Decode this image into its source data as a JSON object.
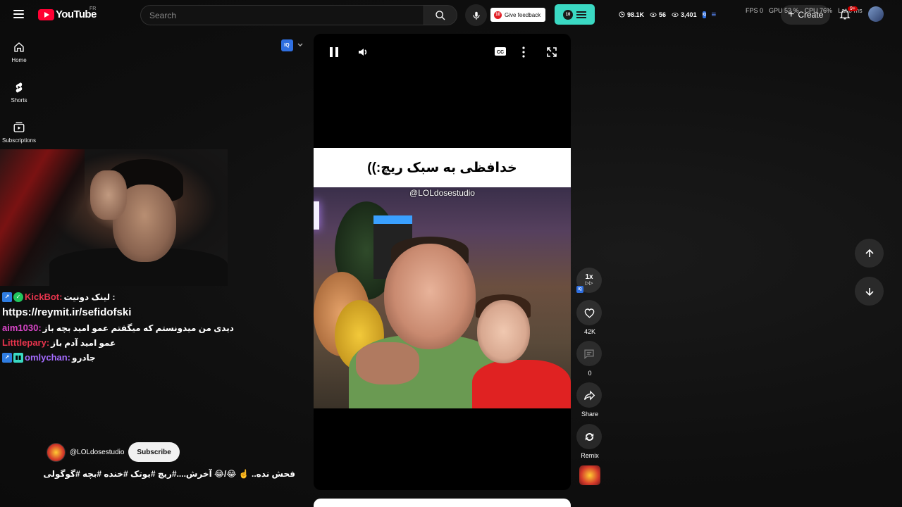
{
  "header": {
    "logo_text": "YouTube",
    "country_code": "FR",
    "search_placeholder": "Search",
    "feedback_label": "Give feedback",
    "stats": {
      "a": "98.1K",
      "b": "56",
      "c": "3,401"
    },
    "perf": {
      "fps": "FPS 0",
      "gpu": "GPU 52 %",
      "cpu": "CPU 76%",
      "lat": "Lat 0 ms"
    },
    "create_label": "Create",
    "notifications": "9+"
  },
  "sidebar": {
    "items": [
      {
        "label": "Home",
        "icon": "home-icon"
      },
      {
        "label": "Shorts",
        "icon": "shorts-icon"
      },
      {
        "label": "Subscriptions",
        "icon": "subscriptions-icon"
      }
    ]
  },
  "chat": {
    "messages": [
      {
        "user": "KickBot:",
        "color": "#e8344d",
        "text": "لینک دونیت :"
      },
      {
        "user": "",
        "color": "#ffffff",
        "text": "https://reymit.ir/sefidofski"
      },
      {
        "user": "aim1030:",
        "color": "#d946c8",
        "text": "دیدی من میدونستم که میگفتم عمو امید بچه باز"
      },
      {
        "user": "Litttlepary:",
        "color": "#e8344d",
        "text": "عمو امید آدم باز"
      },
      {
        "user": "omlychan:",
        "color": "#a46bff",
        "text": "جادرو"
      }
    ]
  },
  "video": {
    "title_overlay": "خدافظی به سبک ریچ:))",
    "watermark": "@LOLdosestudio",
    "channel": "@LOLdosestudio",
    "subscribe_label": "Subscribe",
    "caption": "فحش نده.. ☝️ 😂/😂 آخرش....#ریچ #یوتک #خنده #بچه #گوگولی"
  },
  "actions": {
    "speed": "1x",
    "likes": "42K",
    "comments": "0",
    "share": "Share",
    "remix": "Remix"
  },
  "colors": {
    "accent": "#ff0033",
    "teal": "#3ad9c3",
    "iq_blue": "#2f6fe0"
  }
}
